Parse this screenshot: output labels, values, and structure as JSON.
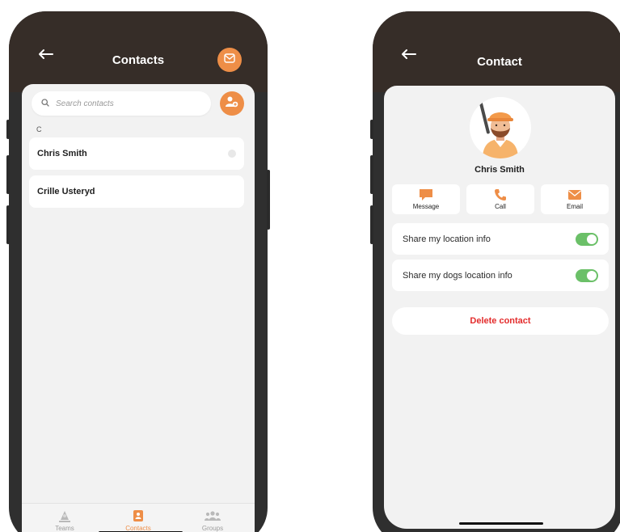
{
  "colors": {
    "accent": "#ee8e47",
    "header": "#362d28",
    "toggle_on": "#6bc068",
    "danger": "#e32c2c"
  },
  "contacts_screen": {
    "title": "Contacts",
    "search": {
      "placeholder": "Search contacts"
    },
    "section_letter": "C",
    "items": [
      {
        "name": "Chris Smith"
      },
      {
        "name": "Crille Usteryd"
      }
    ],
    "tabs": [
      {
        "label": "Teams",
        "icon": "teams-icon"
      },
      {
        "label": "Contacts",
        "icon": "contacts-icon",
        "active": true
      },
      {
        "label": "Groups",
        "icon": "groups-icon"
      }
    ]
  },
  "contact_screen": {
    "title": "Contact",
    "name": "Chris Smith",
    "actions": [
      {
        "label": "Message",
        "icon": "message-icon"
      },
      {
        "label": "Call",
        "icon": "phone-icon"
      },
      {
        "label": "Email",
        "icon": "mail-icon"
      }
    ],
    "toggles": [
      {
        "label": "Share my location info",
        "on": true
      },
      {
        "label": "Share my dogs location info",
        "on": true
      }
    ],
    "delete_label": "Delete contact"
  }
}
